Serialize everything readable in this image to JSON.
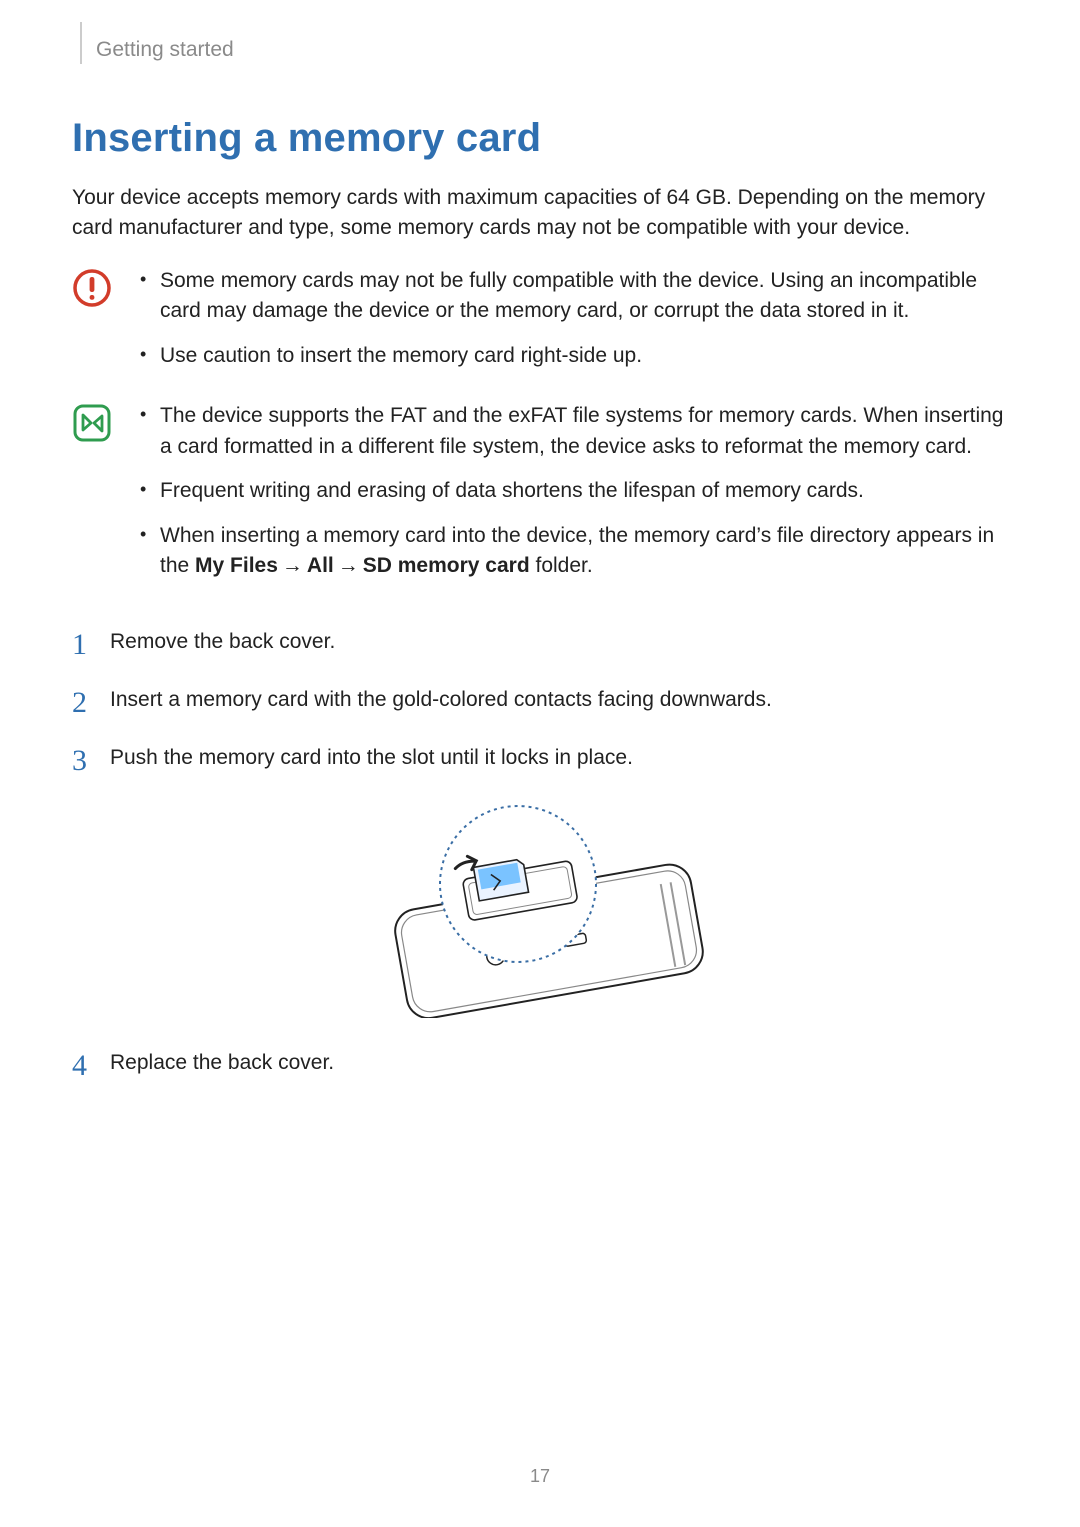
{
  "header": {
    "section": "Getting started"
  },
  "title": "Inserting a memory card",
  "intro": "Your device accepts memory cards with maximum capacities of 64 GB. Depending on the memory card manufacturer and type, some memory cards may not be compatible with your device.",
  "warning_bullets": [
    "Some memory cards may not be fully compatible with the device. Using an incompatible card may damage the device or the memory card, or corrupt the data stored in it.",
    "Use caution to insert the memory card right-side up."
  ],
  "info_bullets": {
    "b1": "The device supports the FAT and the exFAT file systems for memory cards. When inserting a card formatted in a different file system, the device asks to reformat the memory card.",
    "b2": "Frequent writing and erasing of data shortens the lifespan of memory cards.",
    "b3": {
      "pre": "When inserting a memory card into the device, the memory card’s file directory appears in the ",
      "path_my_files": "My Files",
      "arrow": "→",
      "path_all": "All",
      "path_sd": "SD memory card",
      "post": " folder."
    }
  },
  "steps": [
    "Remove the back cover.",
    "Insert a memory card with the gold-colored contacts facing downwards.",
    "Push the memory card into the slot until it locks in place.",
    "Replace the back cover."
  ],
  "page_number": "17",
  "icons": {
    "warning": "warning-icon",
    "info": "note-icon",
    "illustration": "memory-card-insert-illustration"
  }
}
